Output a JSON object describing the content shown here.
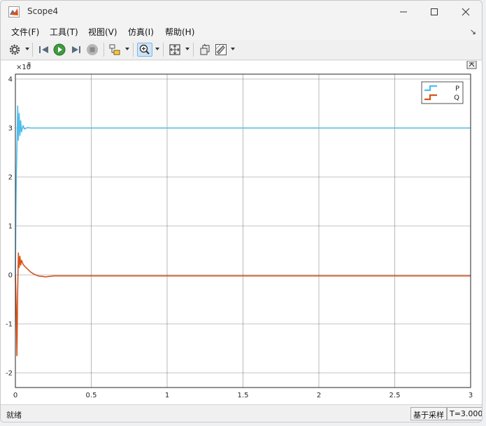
{
  "window": {
    "title": "Scope4",
    "controls": {
      "minimize": "minimize",
      "maximize": "maximize",
      "close": "close"
    }
  },
  "menu": {
    "items": [
      "文件(F)",
      "工具(T)",
      "视图(V)",
      "仿真(I)",
      "帮助(H)"
    ],
    "pin_glyph": "↘"
  },
  "toolbar": {
    "icons": [
      "gear-icon",
      "step-back-icon",
      "run-icon",
      "step-forward-icon",
      "stop-icon",
      "signal-icon",
      "zoom-icon",
      "fit-icon",
      "style-icon",
      "highlight-icon"
    ],
    "zoom_selected": true
  },
  "colors": {
    "P": "#4dbeee",
    "Q": "#d95319",
    "grid": "#262626",
    "background": "#ffffff"
  },
  "status": {
    "left": "就绪",
    "mode": "基于采样",
    "time": "T=3.000"
  },
  "chart_data": {
    "type": "line",
    "y_exponent": "×10^8",
    "y_exponent_text": "8",
    "y_exponent_base": "×10",
    "xlim": [
      0,
      3
    ],
    "ylim": [
      -2.3,
      4.1
    ],
    "xticks": [
      0,
      0.5,
      1,
      1.5,
      2,
      2.5,
      3
    ],
    "xtick_labels": [
      "0",
      "0.5",
      "1",
      "1.5",
      "2",
      "2.5",
      "3"
    ],
    "yticks": [
      -2,
      -1,
      0,
      1,
      2,
      3,
      4
    ],
    "ytick_labels": [
      "-2",
      "-1",
      "0",
      "1",
      "2",
      "3",
      "4"
    ],
    "grid": true,
    "legend_position": "top-right",
    "series": [
      {
        "name": "P",
        "x": [
          0,
          0.003,
          0.006,
          0.01,
          0.015,
          0.02,
          0.025,
          0.03,
          0.035,
          0.04,
          0.05,
          0.06,
          0.08,
          0.1,
          0.15,
          0.2,
          0.5,
          1,
          1.5,
          2,
          2.5,
          3
        ],
        "y": [
          0,
          1.3,
          2.0,
          2.6,
          3.45,
          2.75,
          3.3,
          2.85,
          3.15,
          2.92,
          3.05,
          2.98,
          3.01,
          3.0,
          3.0,
          3.0,
          3.0,
          3.0,
          3.0,
          3.0,
          3.0,
          3.0
        ]
      },
      {
        "name": "Q",
        "x": [
          0,
          0.005,
          0.01,
          0.015,
          0.02,
          0.025,
          0.03,
          0.035,
          0.04,
          0.05,
          0.06,
          0.08,
          0.1,
          0.12,
          0.15,
          0.2,
          0.25,
          0.3,
          0.5,
          1,
          1.5,
          2,
          2.5,
          3
        ],
        "y": [
          0,
          -0.6,
          -1.65,
          -0.3,
          0.45,
          0.15,
          0.38,
          0.2,
          0.3,
          0.22,
          0.18,
          0.12,
          0.06,
          0.02,
          -0.02,
          -0.04,
          -0.02,
          -0.02,
          -0.02,
          -0.02,
          -0.02,
          -0.02,
          -0.02,
          -0.02
        ]
      }
    ]
  }
}
